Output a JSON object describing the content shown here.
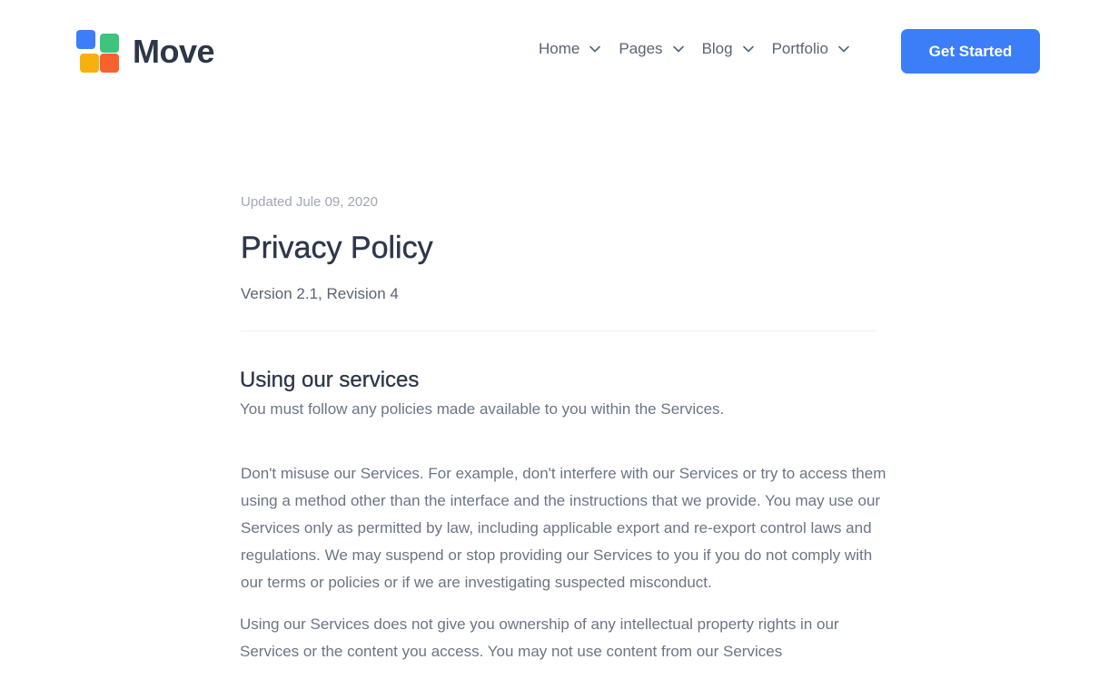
{
  "brand": {
    "name": "Move",
    "colors": {
      "blue": "#3b7ef8",
      "green": "#3dc47e",
      "yellow": "#f7b10e",
      "orange": "#f8622c"
    }
  },
  "nav": {
    "items": [
      {
        "label": "Home",
        "icon": "chevron-down-icon"
      },
      {
        "label": "Pages",
        "icon": "chevron-down-icon"
      },
      {
        "label": "Blog",
        "icon": "chevron-down-icon"
      },
      {
        "label": "Portfolio",
        "icon": "chevron-down-icon"
      }
    ],
    "cta_label": "Get Started",
    "cta_color": "#3b7ef8"
  },
  "document": {
    "updated": "Updated Jule 09, 2020",
    "title": "Privacy Policy",
    "version": "Version 2.1, Revision 4",
    "sections": [
      {
        "heading": "Using our services",
        "lead": "You must follow any policies made available to you within the Services.",
        "paragraphs": [
          "Don't misuse our Services. For example, don't interfere with our Services or try to access them using a method other than the interface and the instructions that we provide. You may use our Services only as permitted by law, including applicable export and re-export control laws and regulations. We may suspend or stop providing our Services to you if you do not comply with our terms or policies or if we are investigating suspected misconduct.",
          "Using our Services does not give you ownership of any intellectual property rights in our Services or the content you access. You may not use content from our Services"
        ]
      }
    ]
  }
}
